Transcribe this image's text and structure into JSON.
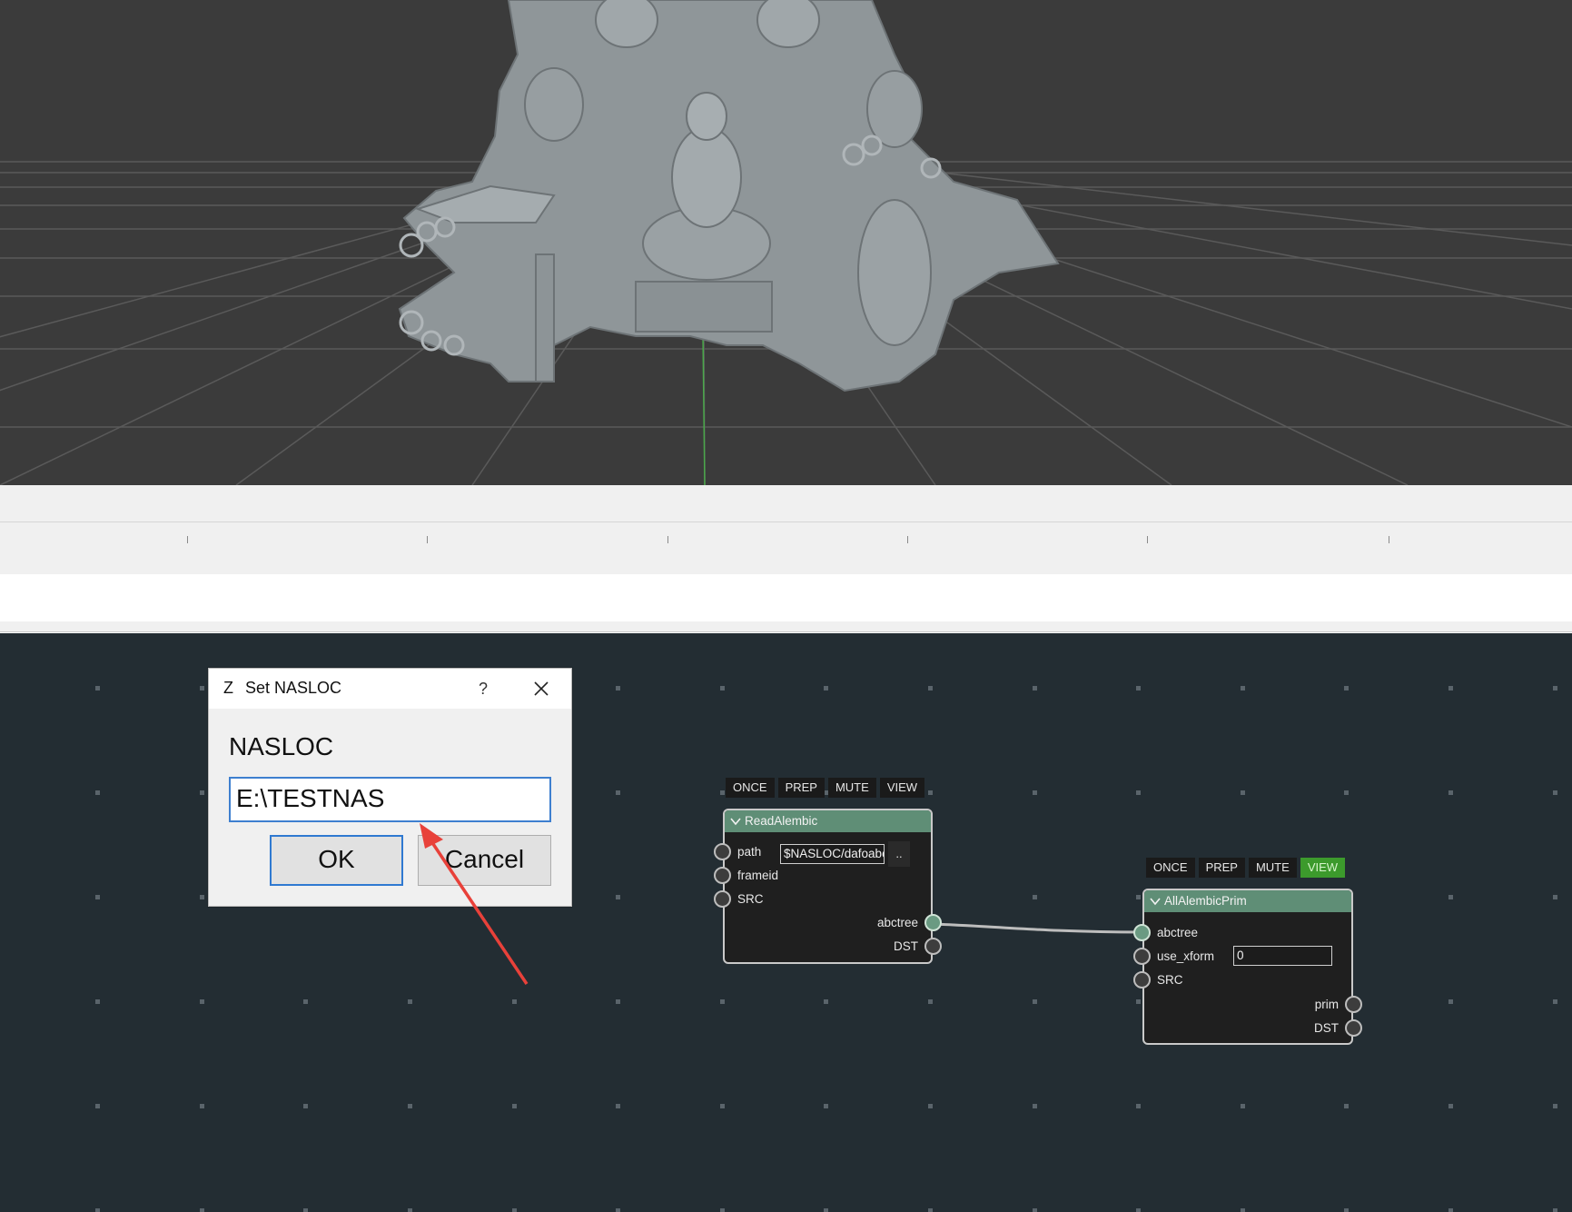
{
  "dialog": {
    "app_icon": "Z",
    "title": "Set NASLOC",
    "help": "?",
    "label": "NASLOC",
    "value": "E:\\TESTNAS",
    "ok": "OK",
    "cancel": "Cancel"
  },
  "nodes": {
    "read_alembic": {
      "options": [
        "ONCE",
        "PREP",
        "MUTE",
        "VIEW"
      ],
      "title": "ReadAlembic",
      "inputs": [
        "path",
        "frameid",
        "SRC"
      ],
      "path_value": "$NASLOC/dafoabc",
      "browse": "..",
      "outputs": [
        "abctree",
        "DST"
      ]
    },
    "all_alembic_prim": {
      "options": [
        "ONCE",
        "PREP",
        "MUTE",
        "VIEW"
      ],
      "active_option": "VIEW",
      "title": "AllAlembicPrim",
      "inputs": [
        "abctree",
        "use_xform",
        "SRC"
      ],
      "use_xform_value": "0",
      "outputs": [
        "prim",
        "DST"
      ]
    }
  },
  "colors": {
    "viewport_bg": "#3b3b3b",
    "editor_bg": "#232d33",
    "node_header": "#5f8e76",
    "view_active": "#3c9a2c",
    "annotation_arrow": "#e8413a"
  }
}
